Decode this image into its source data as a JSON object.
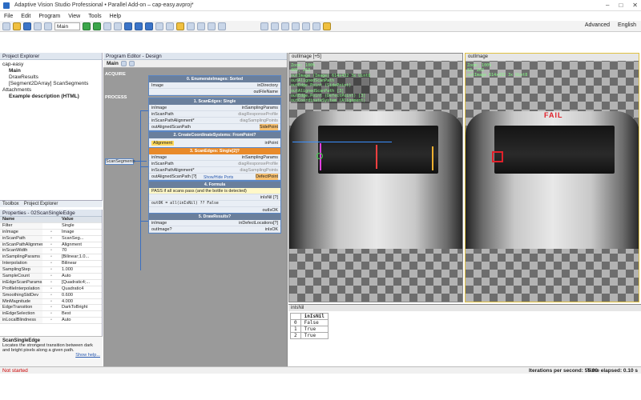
{
  "window": {
    "title": "Adaptive Vision Studio Professional • Parallel Add-on – cap-easy.avproj*",
    "controls": [
      "–",
      "□",
      "✕"
    ]
  },
  "menu": [
    "File",
    "Edit",
    "Program",
    "View",
    "Tools",
    "Help"
  ],
  "toolbar": {
    "program_select": "Main",
    "advanced": "Advanced",
    "language": "English"
  },
  "project_explorer": {
    "title": "Project Explorer",
    "items": [
      "cap-easy",
      "Main",
      "DrawResults",
      "[Segment2DArray] ScanSegments",
      "Attachments",
      "Example description (HTML)"
    ]
  },
  "bottom_tabs": [
    "Toolbox",
    "Project Explorer"
  ],
  "properties": {
    "title": "Properties - 02ScanSingleEdge",
    "headers": [
      "Name",
      "",
      "Value"
    ],
    "filter_label": "Filter",
    "filter_value": "Single",
    "rows": [
      {
        "n": "inImage",
        "v": "Image"
      },
      {
        "n": "inScanPath",
        "v": "ScanSeg..."
      },
      {
        "n": "inScanPathAlignment",
        "v": "Alignment"
      },
      {
        "n": "inScanWidth",
        "v": "70"
      },
      {
        "n": "inSamplingParams",
        "v": "[Bilinear;1.0..."
      },
      {
        "n": "Interpolation",
        "v": "Bilinear"
      },
      {
        "n": "SamplingStep",
        "v": "1.000"
      },
      {
        "n": "SampleCount",
        "v": "Auto"
      },
      {
        "n": "inEdgeScanParams",
        "v": "[Quadratic4;..."
      },
      {
        "n": "ProfileInterpolation",
        "v": "Quadratic4"
      },
      {
        "n": "SmoothingStdDev",
        "v": "0.600"
      },
      {
        "n": "MinMagnitude",
        "v": "4.000"
      },
      {
        "n": "EdgeTransition",
        "v": "DarkToBright"
      },
      {
        "n": "inEdgeSelection",
        "v": "Best"
      },
      {
        "n": "inLocalBlindness",
        "v": "Auto"
      }
    ],
    "desc_title": "ScanSingleEdge",
    "desc_text": "Locates the strongest transition between dark and bright pixels along a given path.",
    "desc_link": "Show help..."
  },
  "editor": {
    "title": "Program Editor - Design",
    "tab": "Main",
    "sections": [
      "ACQUIRE",
      "PROCESS"
    ],
    "external_input": "ScanSegments",
    "nodes": [
      {
        "title": "0. EnumerateImages: Sorted",
        "rows": [
          [
            "Image",
            "inDirectory"
          ],
          [
            "",
            "outFileName"
          ]
        ]
      },
      {
        "title": "1. ScanEdges: Single",
        "rows": [
          [
            "inImage",
            "inSamplingParams"
          ],
          [
            "inScanPath",
            "diagResponseProfile"
          ],
          [
            "inScanPathAlignment*",
            "diagSamplingPoints"
          ],
          [
            "outAlignedScanPath",
            "SidePoint"
          ]
        ]
      },
      {
        "title": "2. CreateCoordinateSystems: FromPoint?",
        "rows": [
          [
            "Alignment",
            "inPoint"
          ]
        ]
      },
      {
        "title": "3. ScanEdges: Single[2]?",
        "rows": [
          [
            "inImage",
            "inSamplingParams"
          ],
          [
            "inScanPath",
            "diagResponseProfile"
          ],
          [
            "inScanPathAlignment*",
            "diagSamplingPoints"
          ],
          [
            "outAlignedScanPath [?]",
            "DefectPoint"
          ]
        ]
      },
      {
        "title": "4. Formula",
        "rows": [
          [
            "PASS if all scans pass (and the bottle is detected)",
            ""
          ],
          [
            "",
            "inIsNil [?]"
          ],
          [
            "outOK = all(inIsNil) ?? False",
            ""
          ],
          [
            "",
            "outIsOK"
          ]
        ]
      },
      {
        "title": "5. DrawResults?",
        "rows": [
          [
            "inImage",
            "inDefectLocations[?]"
          ],
          [
            "outImage?",
            "inIsOK"
          ]
        ]
      }
    ],
    "show_hide_ports": "Show/Hide Ports"
  },
  "view1": {
    "title": "outImage [+5]",
    "zoom": "Zoom: 100%",
    "coords": "405, 263",
    "layers": [
      "outImage (Image) 614x432 3x Uint8",
      "outAlignedScanPath",
      "outEdge.Point (SidePoint)",
      "outAlignedScanPath [3]",
      "outEdge.Point (DefectPoint) [3]",
      "outCoordinateSystem (Alignment)"
    ]
  },
  "view2": {
    "title": "outImage",
    "zoom": "Zoom: 100%",
    "coords": "83, 263",
    "layers": [
      "outImage 614x432 3x Uint8"
    ],
    "result": "FAIL"
  },
  "table": {
    "title": "inIsNil",
    "header": "inIsNil",
    "rows": [
      [
        "0",
        "False"
      ],
      [
        "1",
        "True"
      ],
      [
        "2",
        "True"
      ]
    ]
  },
  "status": {
    "left": "Not started",
    "iterations": "Iterations per second: 55.90",
    "elapsed": "Time elapsed: 0.10 s"
  },
  "colors": {
    "accent": "#3a6fc0",
    "fail": "#e0202a",
    "overlay": "#88ff88"
  }
}
